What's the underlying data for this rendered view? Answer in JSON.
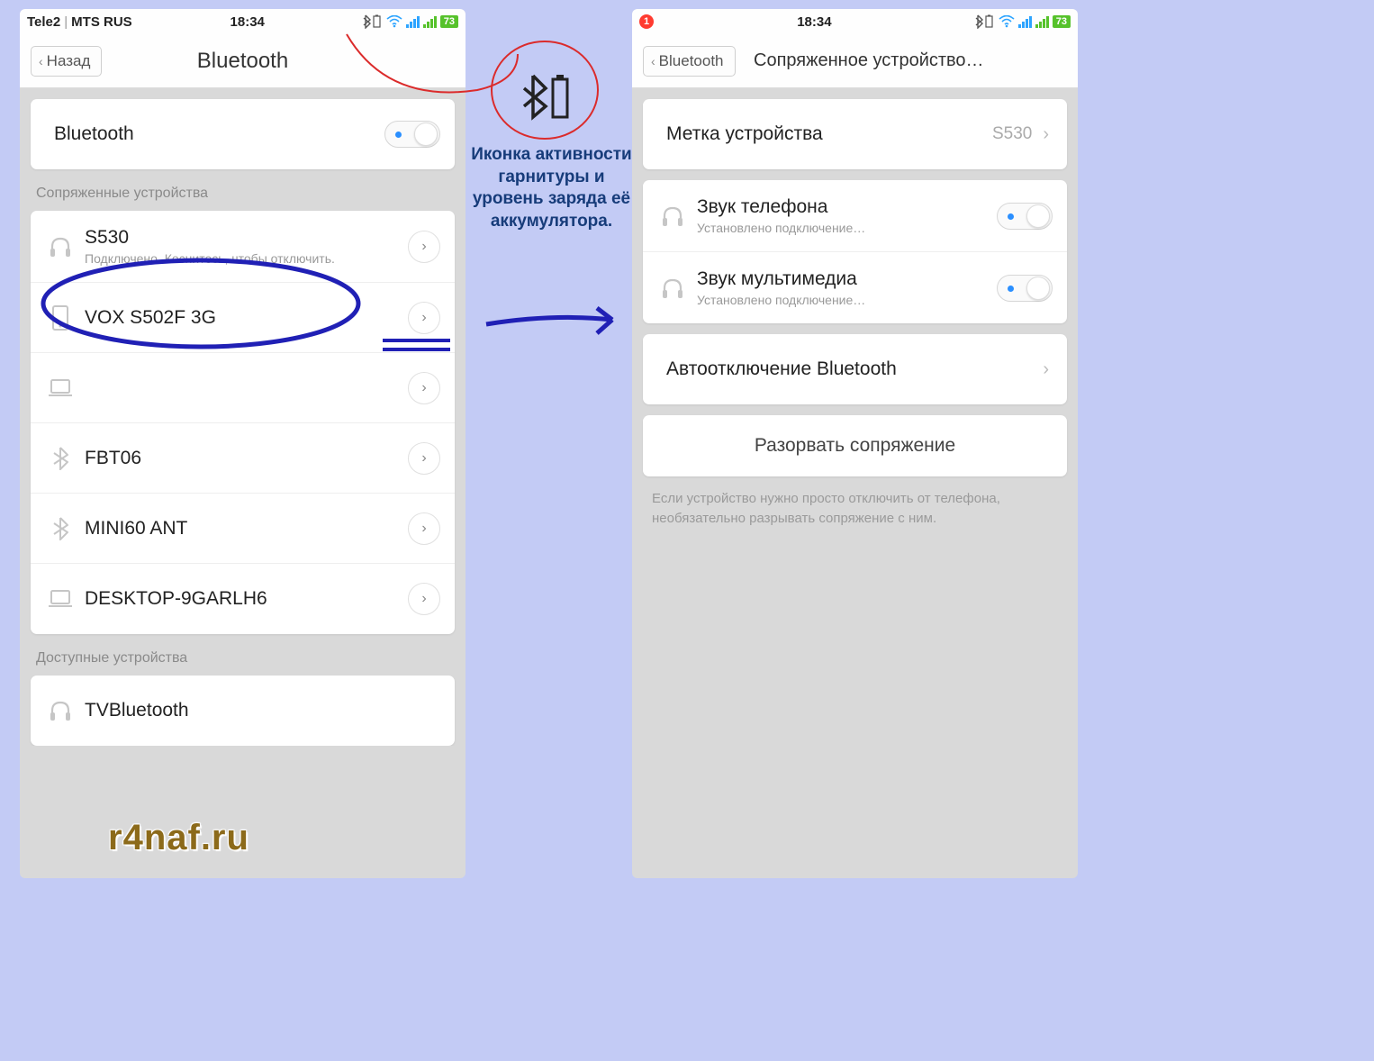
{
  "left": {
    "status": {
      "carrier1": "Tele2",
      "carrier2": "MTS RUS",
      "time": "18:34",
      "battery": "73"
    },
    "nav": {
      "back": "Назад",
      "title": "Bluetooth"
    },
    "bt_toggle_label": "Bluetooth",
    "paired_header": "Сопряженные устройства",
    "paired": [
      {
        "name": "S530",
        "sub": "Подключено. Коснитесь, чтобы отключить.",
        "icon": "headphones"
      },
      {
        "name": "VOX S502F 3G",
        "sub": "",
        "icon": "phone"
      },
      {
        "name": "",
        "sub": "",
        "icon": "laptop"
      },
      {
        "name": "FBT06",
        "sub": "",
        "icon": "bluetooth"
      },
      {
        "name": "MINI60 ANT",
        "sub": "",
        "icon": "bluetooth"
      },
      {
        "name": "DESKTOP-9GARLH6",
        "sub": "",
        "icon": "laptop"
      }
    ],
    "available_header": "Доступные устройства",
    "available": [
      {
        "name": "TVBluetooth",
        "icon": "headphones"
      }
    ]
  },
  "right": {
    "status": {
      "notif": "1",
      "time": "18:34",
      "battery": "73"
    },
    "nav": {
      "back": "Bluetooth",
      "title": "Сопряженное устройство…"
    },
    "device_label_row": {
      "title": "Метка устройства",
      "value": "S530"
    },
    "phone_audio": {
      "title": "Звук телефона",
      "sub": "Установлено подключение…"
    },
    "media_audio": {
      "title": "Звук мультимедиа",
      "sub": "Установлено подключение…"
    },
    "auto_off": "Автоотключение Bluetooth",
    "unpair": "Разорвать сопряжение",
    "hint": "Если устройство нужно просто отключить от телефона, необязательно разрывать сопряжение с ним."
  },
  "annotation_caption": "Иконка активности гарнитуры и уровень заряда её аккумулятора.",
  "watermark": "r4naf.ru"
}
